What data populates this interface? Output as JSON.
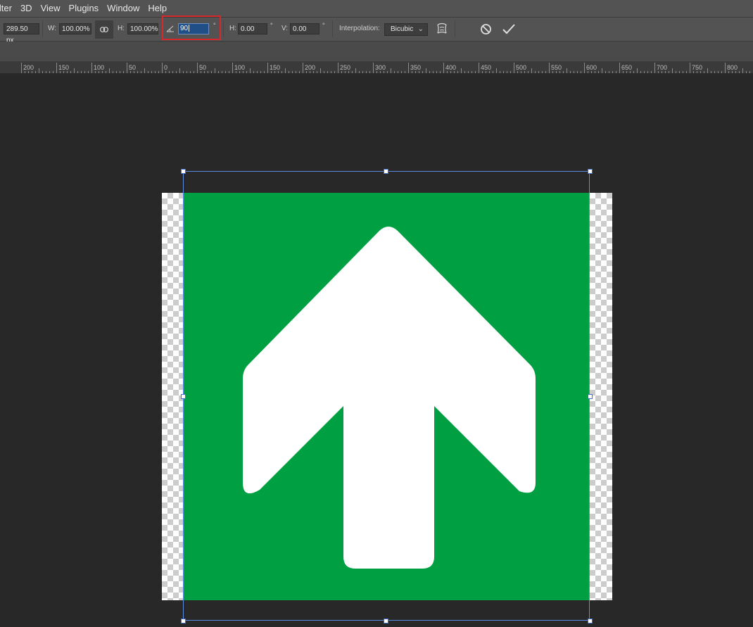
{
  "menu": {
    "items": [
      "ilter",
      "3D",
      "View",
      "Plugins",
      "Window",
      "Help"
    ]
  },
  "options": {
    "x_value": "289.50 px",
    "w_label": "W:",
    "w_value": "100.00%",
    "h_label": "H:",
    "h_value": "100.00%",
    "angle_value": "90",
    "angle_unit": "°",
    "skew_h_label": "H:",
    "skew_h_value": "0.00",
    "skew_h_unit": "°",
    "skew_v_label": "V:",
    "skew_v_value": "0.00",
    "skew_v_unit": "°",
    "interpolation_label": "Interpolation:",
    "interpolation_value": "Bicubic"
  },
  "ruler": {
    "labels": [
      "200",
      "150",
      "100",
      "50",
      "0",
      "50",
      "100",
      "150",
      "200",
      "250",
      "300",
      "350",
      "400",
      "450",
      "500",
      "550",
      "600",
      "650",
      "700",
      "750",
      "800"
    ]
  },
  "colors": {
    "sign_green": "#009f42",
    "highlight_red": "#d9282b",
    "transform_blue": "#5b8be0"
  },
  "icons": {
    "link": "link-icon",
    "angle": "angle-icon",
    "warp": "warp-icon",
    "cancel": "cancel-icon",
    "commit": "checkmark-icon"
  }
}
